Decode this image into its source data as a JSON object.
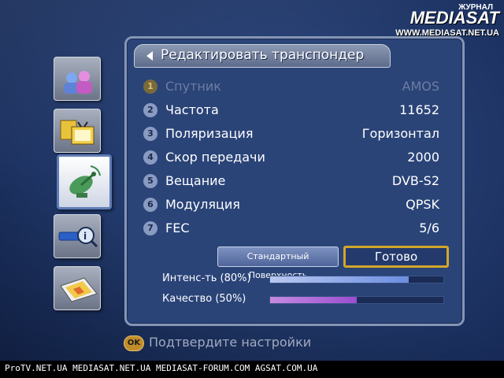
{
  "watermark": {
    "kicker": "ЖУРНАЛ",
    "logo": "MEDIASAT",
    "url": "WWW.MEDIASAT.NET.UA"
  },
  "sidebar_icons": [
    {
      "name": "users-icon",
      "active": false
    },
    {
      "name": "tv-folder-icon",
      "active": false
    },
    {
      "name": "satellite-dish-icon",
      "active": true
    },
    {
      "name": "info-search-icon",
      "active": false
    },
    {
      "name": "smartcard-icon",
      "active": false
    }
  ],
  "panel": {
    "title": "Редактировать транспондер"
  },
  "rows": [
    {
      "num": "1",
      "label": "Спутник",
      "value": "AMOS",
      "dim": true
    },
    {
      "num": "2",
      "label": "Частота",
      "value": "11652",
      "dim": false
    },
    {
      "num": "3",
      "label": "Поляризация",
      "value": "Горизонтал",
      "dim": false
    },
    {
      "num": "4",
      "label": "Скор передачи",
      "value": "2000",
      "dim": false
    },
    {
      "num": "5",
      "label": "Вещание",
      "value": "DVB-S2",
      "dim": false
    },
    {
      "num": "6",
      "label": "Модуляция",
      "value": "QPSK",
      "dim": false
    },
    {
      "num": "7",
      "label": "FEC",
      "value": "5/6",
      "dim": false
    }
  ],
  "buttons": {
    "standard": "Стандартный Поверхность",
    "done": "Готово"
  },
  "meters": {
    "intensity": {
      "label": "Интенс-ть (80%)",
      "percent": 80,
      "color": "#b8c8f0"
    },
    "quality": {
      "label": "Качество (50%)",
      "percent": 50,
      "color": "#c68ae0"
    }
  },
  "footer": {
    "ok": "OK",
    "hint": "Подтвердите настройки"
  },
  "strip": "ProTV.NET.UA  MEDIASAT.NET.UA  MEDIASAT-FORUM.COM  AGSAT.COM.UA"
}
